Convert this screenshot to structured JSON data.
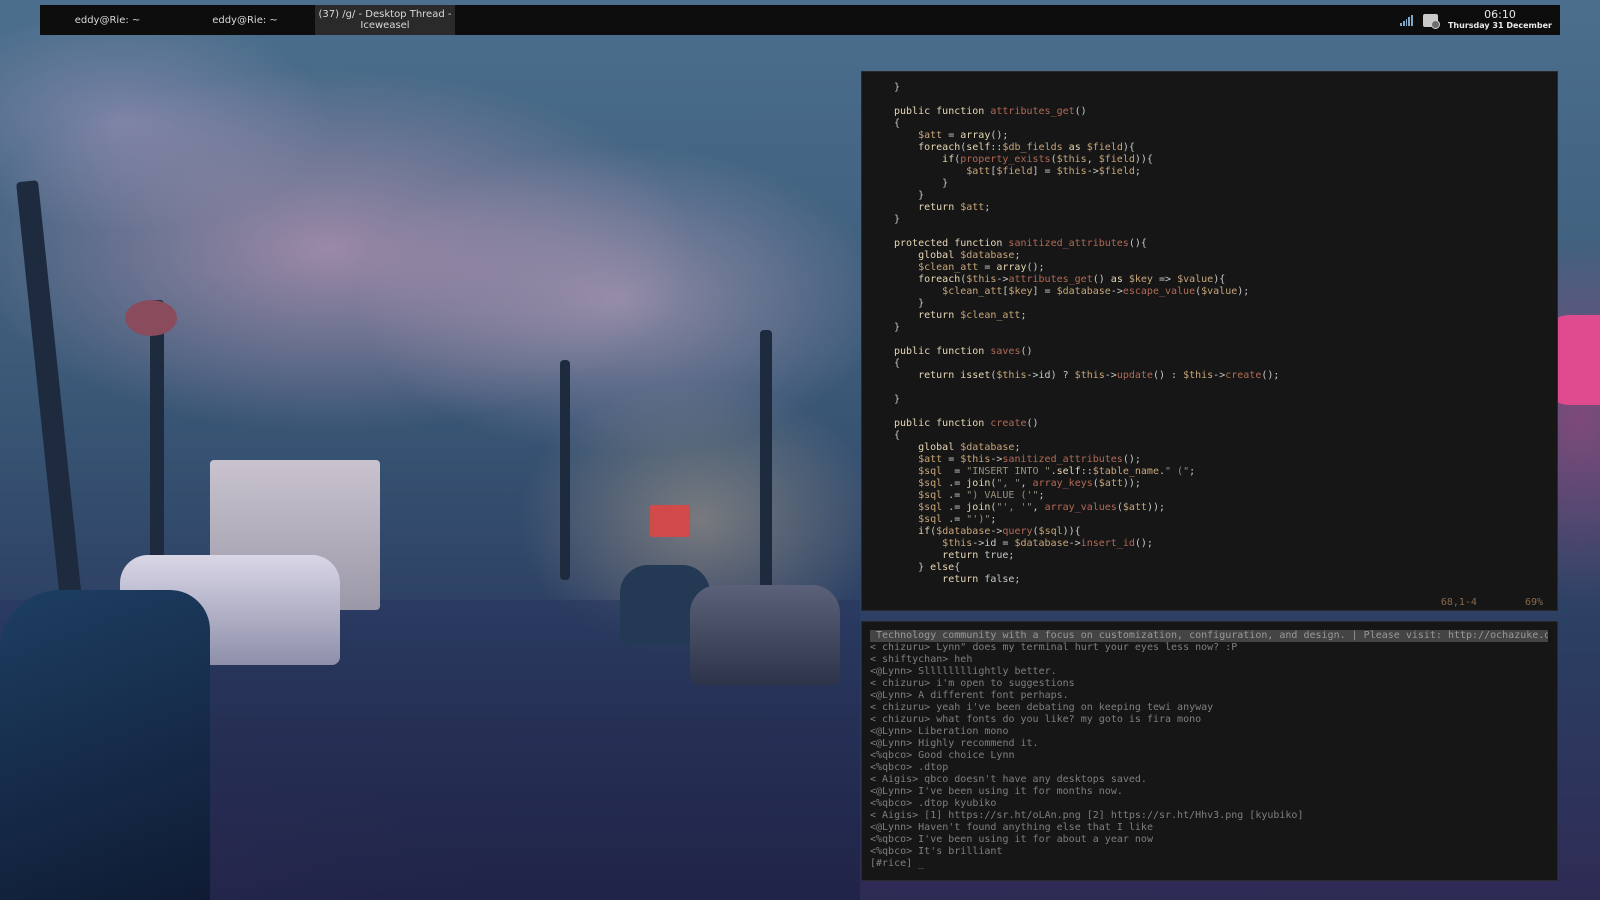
{
  "panel": {
    "tasks": [
      {
        "label": "eddy@Rie: ~"
      },
      {
        "label": "eddy@Rie: ~"
      },
      {
        "label": "(37) /g/ - Desktop Thread - Iceweasel"
      }
    ],
    "tray": {
      "time": "06:10",
      "date": "Thursday 31 December",
      "icons": [
        "signal-icon",
        "folder-icon"
      ]
    }
  },
  "editor": {
    "lines": [
      "}",
      "",
      "public function attributes_get()",
      "{",
      "    $att = array();",
      "    foreach(self::$db_fields as $field){",
      "        if(property_exists($this, $field)){",
      "            $att[$field] = $this->$field;",
      "        }",
      "    }",
      "    return $att;",
      "}",
      "",
      "protected function sanitized_attributes(){",
      "    global $database;",
      "    $clean_att = array();",
      "    foreach($this->attributes_get() as $key => $value){",
      "        $clean_att[$key] = $database->escape_value($value);",
      "    }",
      "    return $clean_att;",
      "}",
      "",
      "public function saves()",
      "{",
      "    return isset($this->id) ? $this->update() : $this->create();",
      "",
      "}",
      "",
      "public function create()",
      "{",
      "    global $database;",
      "    $att = $this->sanitized_attributes();",
      "    $sql  = \"INSERT INTO \".self::$table_name.\" (\";",
      "    $sql .= join(\", \", array_keys($att));",
      "    $sql .= \") VALUE ('\";",
      "    $sql .= join(\"', '\", array_values($att));",
      "    $sql .= \"')\";",
      "    if($database->query($sql)){",
      "        $this->id = $database->insert_id();",
      "        return true;",
      "    } else{",
      "        return false;"
    ],
    "status_position": "68,1-4",
    "status_percent": "69%"
  },
  "irc": {
    "topic": " Technology community with a focus on customization, configuration, and design. | Please visit: http://ochazuke.o",
    "messages": [
      "< chizuru> Lynn\" does my terminal hurt your eyes less now? :P",
      "< shiftychan> heh",
      "<@Lynn> Sllllllllightly better.",
      "< chizuru> i'm open to suggestions",
      "<@Lynn> A different font perhaps.",
      "< chizuru> yeah i've been debating on keeping tewi anyway",
      "< chizuru> what fonts do you like? my goto is fira mono",
      "<@Lynn> Liberation mono",
      "<@Lynn> Highly recommend it.",
      "<%qbco> Good choice Lynn",
      "<%qbco> .dtop",
      "< Aigis> qbco doesn't have any desktops saved.",
      "<@Lynn> I've been using it for months now.",
      "<%qbco> .dtop kyubiko",
      "< Aigis> [1] https://sr.ht/oLAn.png [2] https://sr.ht/Hhv3.png [kyubiko]",
      "<@Lynn> Haven't found anything else that I like",
      "<%qbco> I've been using it for about a year now",
      "<%qbco> It's brilliant"
    ],
    "prompt": "[#rice] _"
  }
}
